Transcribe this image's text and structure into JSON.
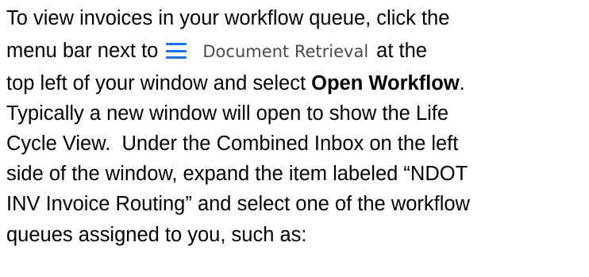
{
  "paragraph": {
    "line1": "To view invoices in your workflow queue, click the",
    "line2_before": "menu bar next to",
    "menu_icon": "hamburger-menu-icon",
    "menu_icon_color": "#1a73e8",
    "ui_label": "Document Retrieval",
    "line2_after": "at the",
    "line3_before": "top left of your window and select ",
    "line3_bold": "Open Workflow",
    "line3_after": ".",
    "line4": "Typically a new window will open to show the Life",
    "line5": "Cycle View.  Under the Combined Inbox on the left",
    "line6": "side of the window, expand the item labeled “NDOT",
    "line7": "INV Invoice Routing” and select one of the workflow",
    "line8": "queues assigned to you, such as:"
  }
}
